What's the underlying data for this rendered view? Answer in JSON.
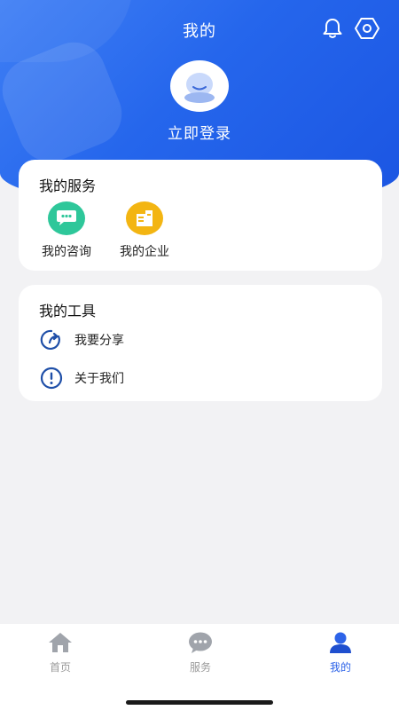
{
  "header": {
    "title": "我的",
    "login_label": "立即登录",
    "accent_color": "#2566ec"
  },
  "icons": {
    "bell": "bell-icon",
    "settings": "settings-icon",
    "avatar": "user-avatar-icon"
  },
  "services": {
    "title": "我的服务",
    "items": [
      {
        "label": "我的咨询",
        "icon": "chat-icon",
        "color": "#2ec79a"
      },
      {
        "label": "我的企业",
        "icon": "building-icon",
        "color": "#f3b512"
      }
    ]
  },
  "tools": {
    "title": "我的工具",
    "items": [
      {
        "label": "我要分享",
        "icon": "share-icon"
      },
      {
        "label": "关于我们",
        "icon": "info-icon"
      }
    ]
  },
  "tabbar": {
    "items": [
      {
        "label": "首页",
        "icon": "home-icon"
      },
      {
        "label": "服务",
        "icon": "chat-bubble-icon"
      },
      {
        "label": "我的",
        "icon": "user-icon",
        "active": true
      }
    ]
  }
}
